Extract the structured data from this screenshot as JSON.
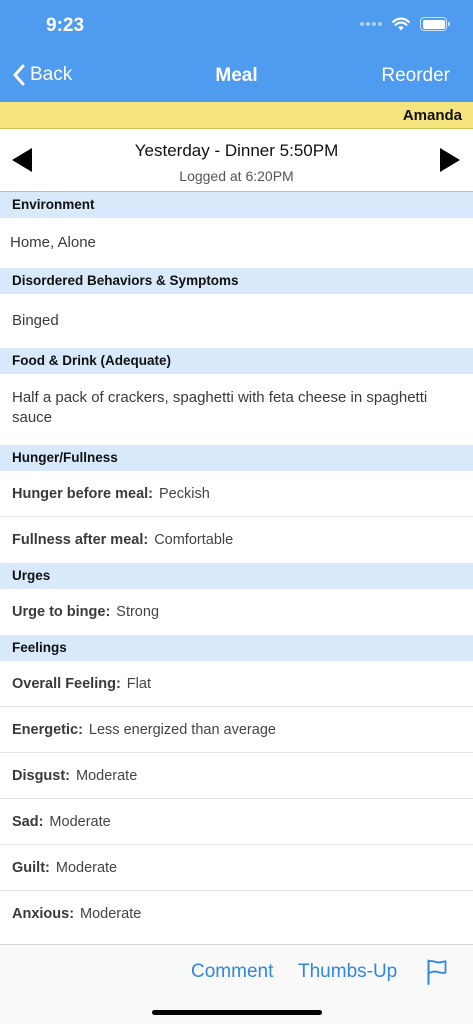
{
  "status": {
    "time": "9:23"
  },
  "nav": {
    "back_label": "Back",
    "title": "Meal",
    "reorder_label": "Reorder"
  },
  "user": {
    "name": "Amanda"
  },
  "meal": {
    "title": "Yesterday - Dinner 5:50PM",
    "logged": "Logged at 6:20PM"
  },
  "sections": {
    "environment": {
      "header": "Environment",
      "value": "Home, Alone"
    },
    "behaviors": {
      "header": "Disordered Behaviors & Symptoms",
      "value": "Binged"
    },
    "food": {
      "header": "Food & Drink (Adequate)",
      "value": "Half a pack of crackers, spaghetti with feta cheese in spaghetti sauce"
    },
    "hunger": {
      "header": "Hunger/Fullness",
      "rows": [
        {
          "label": "Hunger before meal:",
          "value": "Peckish"
        },
        {
          "label": "Fullness after meal:",
          "value": "Comfortable"
        }
      ]
    },
    "urges": {
      "header": "Urges",
      "rows": [
        {
          "label": "Urge to binge:",
          "value": "Strong"
        }
      ]
    },
    "feelings": {
      "header": "Feelings",
      "rows": [
        {
          "label": "Overall Feeling:",
          "value": "Flat"
        },
        {
          "label": "Energetic:",
          "value": "Less energized than average"
        },
        {
          "label": "Disgust:",
          "value": "Moderate"
        },
        {
          "label": "Sad:",
          "value": "Moderate"
        },
        {
          "label": "Guilt:",
          "value": "Moderate"
        },
        {
          "label": "Anxious:",
          "value": "Moderate"
        }
      ]
    }
  },
  "toolbar": {
    "comment_label": "Comment",
    "thumbs_label": "Thumbs-Up",
    "flag_icon": "flag-icon"
  },
  "colors": {
    "nav_blue": "#4e9bef",
    "user_yellow": "#f5e37d",
    "section_blue": "#d8e9fb",
    "link_blue": "#2f87e0"
  }
}
